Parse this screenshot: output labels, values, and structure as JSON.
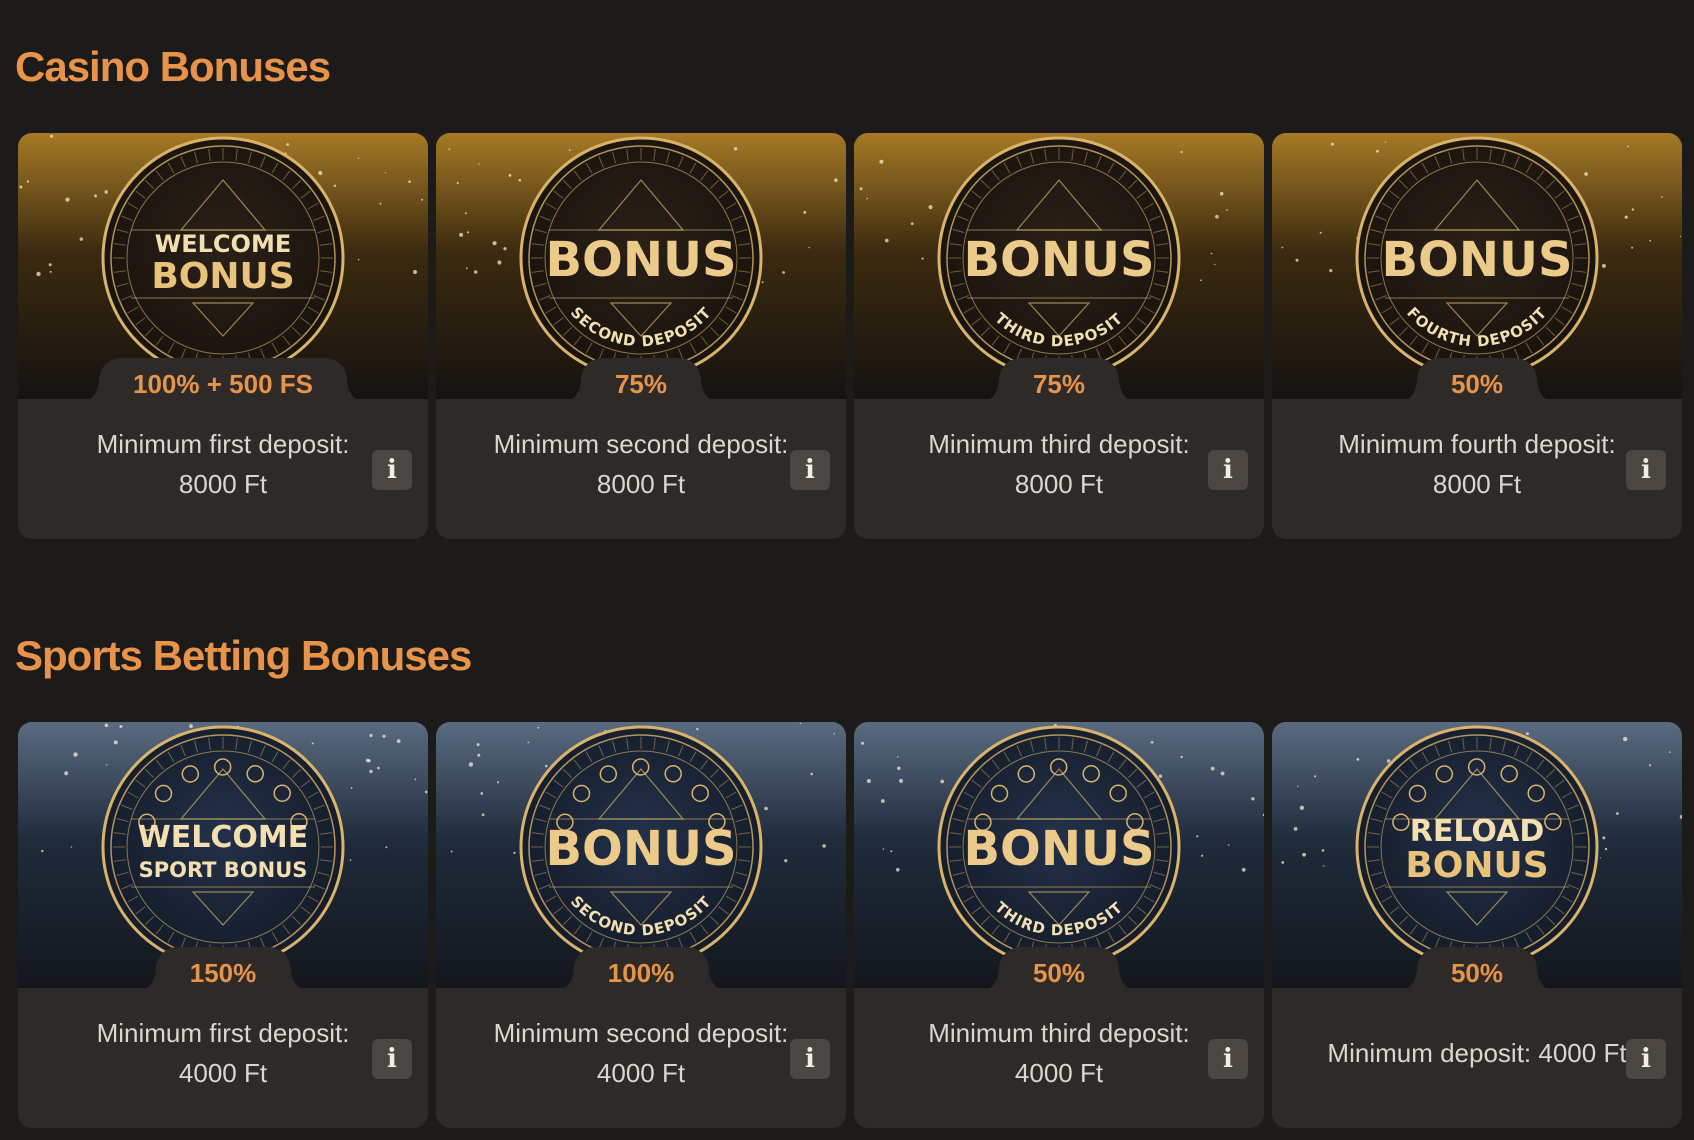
{
  "casino": {
    "title": "Casino Bonuses",
    "cards": [
      {
        "badge_top": "WELCOME",
        "badge_main": "BONUS",
        "badge_sub": "",
        "percent": "100% + 500 FS",
        "desc": "Minimum first deposit: 8000 Ft"
      },
      {
        "badge_top": "",
        "badge_main": "BONUS",
        "badge_sub": "SECOND DEPOSIT",
        "percent": "75%",
        "desc": "Minimum second deposit: 8000 Ft"
      },
      {
        "badge_top": "",
        "badge_main": "BONUS",
        "badge_sub": "THIRD DEPOSIT",
        "percent": "75%",
        "desc": "Minimum third deposit: 8000 Ft"
      },
      {
        "badge_top": "",
        "badge_main": "BONUS",
        "badge_sub": "FOURTH DEPOSIT",
        "percent": "50%",
        "desc": "Minimum fourth deposit: 8000 Ft"
      }
    ]
  },
  "sports": {
    "title": "Sports Betting Bonuses",
    "cards": [
      {
        "badge_top": "WELCOME",
        "badge_main": "SPORT BONUS",
        "badge_sub": "",
        "percent": "150%",
        "desc": "Minimum first deposit: 4000 Ft"
      },
      {
        "badge_top": "",
        "badge_main": "BONUS",
        "badge_sub": "SECOND DEPOSIT",
        "percent": "100%",
        "desc": "Minimum second deposit: 4000 Ft"
      },
      {
        "badge_top": "",
        "badge_main": "BONUS",
        "badge_sub": "THIRD DEPOSIT",
        "percent": "50%",
        "desc": "Minimum third deposit: 4000 Ft"
      },
      {
        "badge_top": "RELOAD",
        "badge_main": "BONUS",
        "badge_sub": "",
        "percent": "50%",
        "desc": "Minimum deposit: 4000 Ft"
      }
    ]
  },
  "info_label": "i",
  "colors": {
    "background": "#1d1b1a",
    "card": "#2d2a27",
    "accent": "#e8934a",
    "gold": "#d9b36a",
    "casino_bg": "#3a2a10",
    "sports_bg": "#1d2a3d"
  }
}
